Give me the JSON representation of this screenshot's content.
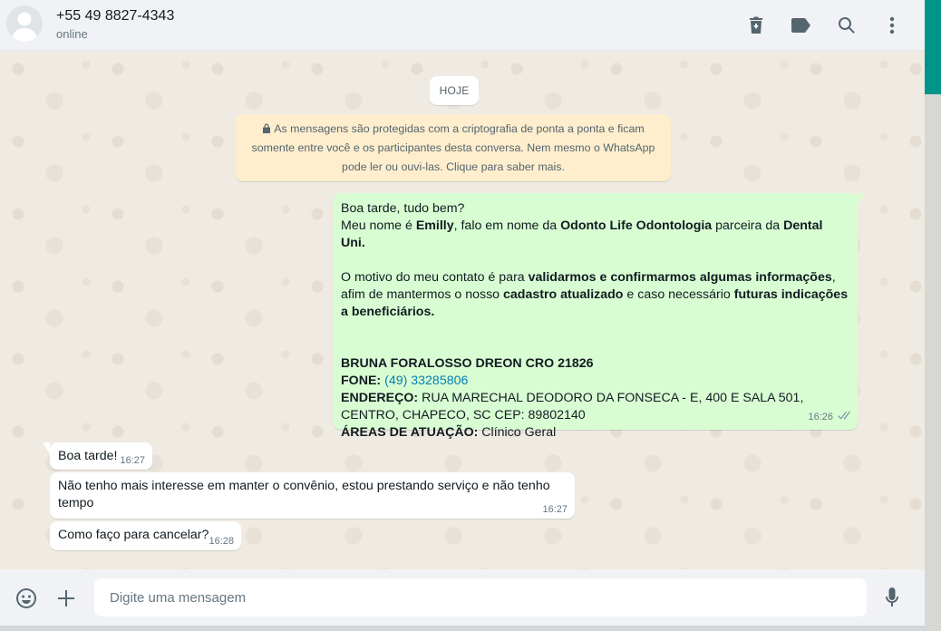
{
  "header": {
    "contact_name": "+55 49 8827-4343",
    "status": "online",
    "icons": [
      "delete-icon",
      "label-icon",
      "search-icon",
      "menu-icon"
    ]
  },
  "chat": {
    "date_chip": "HOJE",
    "encryption_notice": "As mensagens são protegidas com a criptografia de ponta a ponta e ficam somente entre você e os participantes desta conversa. Nem mesmo o WhatsApp pode ler ou ouvi-las. Clique para saber mais.",
    "messages": [
      {
        "direction": "outgoing",
        "greeting": "Boa tarde, tudo bem?",
        "intro_prefix": "Meu nome é ",
        "intro_name": "Emilly",
        "intro_mid": ", falo em nome da ",
        "intro_company": "Odonto Life Odontologia",
        "intro_mid2": " parceira da ",
        "intro_partner": "Dental Uni.",
        "reason_prefix": "O motivo do meu contato é para ",
        "reason_bold1": "validarmos e confirmarmos algumas informações",
        "reason_mid": ", afim de mantermos o nosso ",
        "reason_bold2": "cadastro atualizado",
        "reason_mid2": " e caso necessário ",
        "reason_bold3": "futuras indicações a beneficiários.",
        "doctor": "BRUNA FORALOSSO DREON CRO 21826",
        "phone_label": "FONE:",
        "phone_value": "(49) 33285806",
        "address_label": "ENDEREÇO:",
        "address_value": "RUA MARECHAL DEODORO DA FONSECA - E, 400 E SALA 501, CENTRO, CHAPECO, SC CEP: 89802140",
        "areas_label": "ÁREAS DE ATUAÇÃO:",
        "areas_value": "Clínico Geral",
        "time": "16:26"
      },
      {
        "direction": "incoming",
        "text": "Boa tarde!",
        "time": "16:27"
      },
      {
        "direction": "incoming",
        "text": "Não tenho mais interesse em manter o convênio, estou prestando serviço e não tenho tempo",
        "time": "16:27"
      },
      {
        "direction": "incoming",
        "text": "Como faço para cancelar?",
        "time": "16:28"
      }
    ]
  },
  "footer": {
    "placeholder": "Digite uma mensagem",
    "icons": [
      "emoji-icon",
      "attach-icon",
      "mic-icon"
    ]
  },
  "colors": {
    "outgoing_bubble": "#d9fdd3",
    "incoming_bubble": "#ffffff",
    "notice_bg": "#ffeecd",
    "accent": "#009588",
    "link": "#027eb5"
  }
}
